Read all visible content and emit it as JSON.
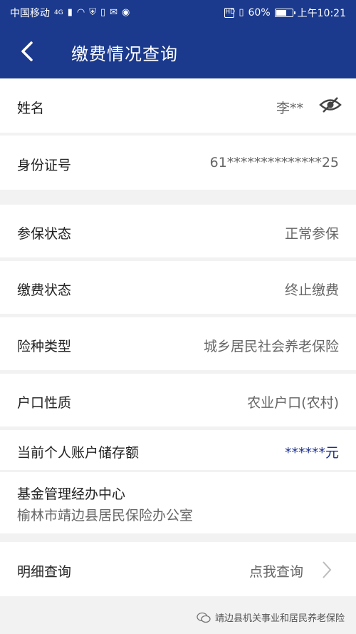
{
  "status_bar": {
    "carrier": "中国移动",
    "network": "4G",
    "battery": "60%",
    "time": "上午10:21",
    "hd": "HD"
  },
  "header": {
    "title": "缴费情况查询"
  },
  "rows": [
    {
      "label": "姓名",
      "value": "李**"
    },
    {
      "label": "身份证号",
      "value": "61**************25"
    },
    {
      "label": "参保状态",
      "value": "正常参保"
    },
    {
      "label": "缴费状态",
      "value": "终止缴费"
    },
    {
      "label": "险种类型",
      "value": "城乡居民社会养老保险"
    },
    {
      "label": "户口性质",
      "value": "农业户口(农村)"
    },
    {
      "label": "当前个人账户储存额",
      "value": "******元"
    }
  ],
  "fund_center": {
    "label": "基金管理经办中心",
    "value": "榆林市靖边县居民保险办公室"
  },
  "detail": {
    "label": "明细查询",
    "action": "点我查询"
  },
  "watermark": "靖边县机关事业和居民养老保险",
  "colors": {
    "header_bg": "#1b3a8d",
    "balance_value": "#1b2f8a"
  }
}
